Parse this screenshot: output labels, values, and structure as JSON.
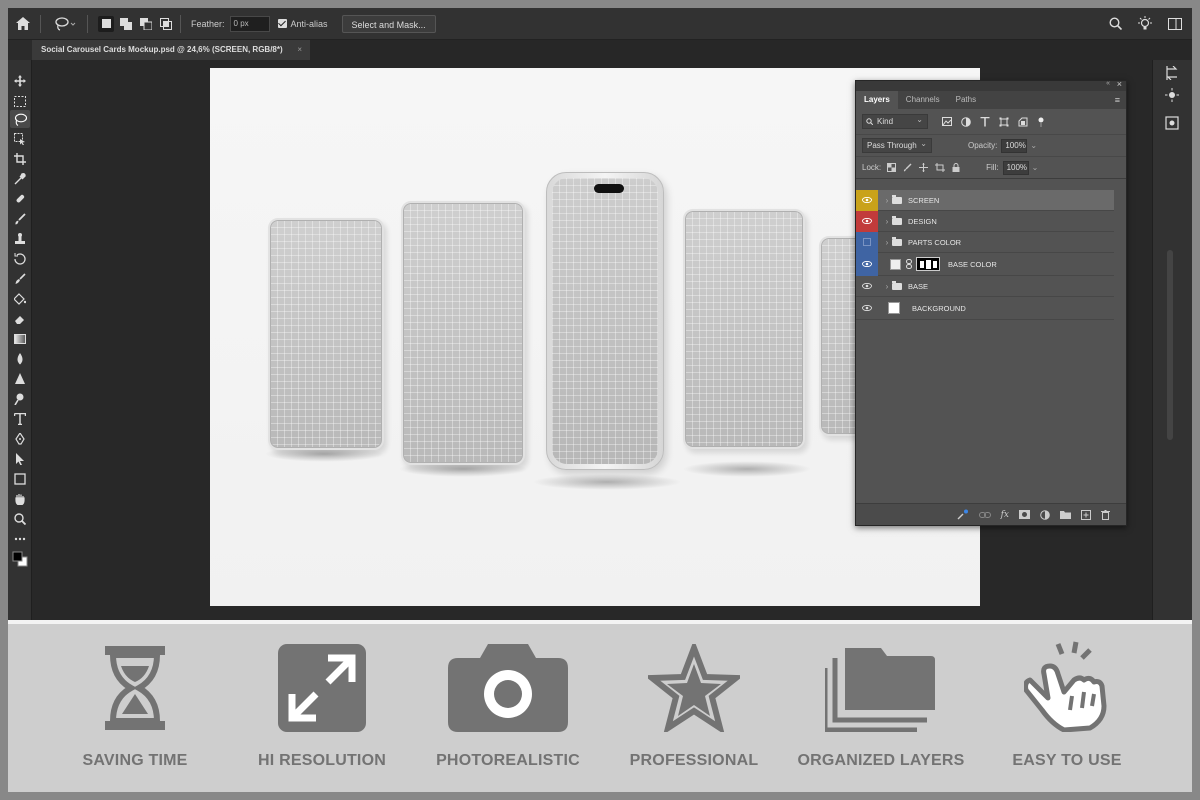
{
  "optionbar": {
    "feather_label": "Feather:",
    "feather_value": "0 px",
    "antialias_label": "Anti-alias",
    "select_mask_label": "Select and Mask..."
  },
  "document": {
    "tab_title": "Social Carousel Cards Mockup.psd @ 24,6% (SCREEN, RGB/8*)",
    "tab_close": "×"
  },
  "layers_panel": {
    "tabs": [
      "Layers",
      "Channels",
      "Paths"
    ],
    "filter_kind": "Kind",
    "blend_mode": "Pass Through",
    "opacity_label": "Opacity:",
    "opacity_value": "100%",
    "lock_label": "Lock:",
    "fill_label": "Fill:",
    "fill_value": "100%",
    "layers": [
      {
        "name": "SCREEN",
        "type": "group",
        "visible": true,
        "tag_color": "#c9a21a"
      },
      {
        "name": "DESIGN",
        "type": "group",
        "visible": true,
        "tag_color": "#c23b3b"
      },
      {
        "name": "PARTS COLOR",
        "type": "group",
        "visible": false,
        "tag_color": "#3f64a3"
      },
      {
        "name": "BASE COLOR",
        "type": "layer_mask",
        "visible": true,
        "tag_color": "#3f64a3"
      },
      {
        "name": "BASE",
        "type": "group",
        "visible": true,
        "tag_color": ""
      },
      {
        "name": "BACKGROUND",
        "type": "layer",
        "visible": true,
        "tag_color": ""
      }
    ],
    "bottom_fx": "fx"
  },
  "features": [
    {
      "label": "SAVING TIME",
      "icon": "hourglass-icon"
    },
    {
      "label": "HI RESOLUTION",
      "icon": "expand-arrows-icon"
    },
    {
      "label": "PHOTOREALISTIC",
      "icon": "camera-icon"
    },
    {
      "label": "PROFESSIONAL",
      "icon": "star-icon"
    },
    {
      "label": "ORGANIZED LAYERS",
      "icon": "stacked-folders-icon"
    },
    {
      "label": "EASY TO USE",
      "icon": "tap-hand-icon"
    }
  ],
  "colors": {
    "feature_gray": "#737373",
    "panel_bg": "#535353",
    "ui_dark": "#323232"
  }
}
